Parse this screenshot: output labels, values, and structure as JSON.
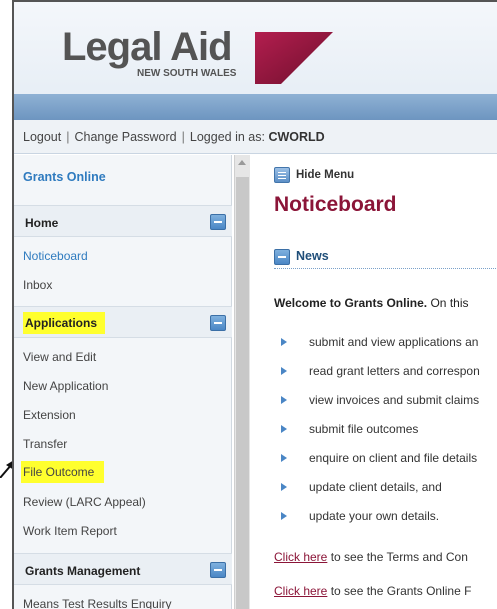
{
  "brand": {
    "logo_text": "Legal Aid",
    "logo_sub": "NEW SOUTH WALES",
    "colors": {
      "maroon": "#8b1538",
      "blue": "#2f7bbf",
      "highlight": "#ffff2e"
    }
  },
  "topbar": {
    "logout": "Logout",
    "sep1": "|",
    "change_password": "Change Password",
    "sep2": "|",
    "logged_in_label": "Logged in as:",
    "username": "CWORLD"
  },
  "sidebar": {
    "title": "Grants Online",
    "sections": [
      {
        "label": "Home",
        "items": [
          "Noticeboard",
          "Inbox"
        ]
      },
      {
        "label": "Applications",
        "items": [
          "View and Edit",
          "New Application",
          "Extension",
          "Transfer",
          "File Outcome",
          "Review (LARC Appeal)",
          "Work Item Report"
        ]
      },
      {
        "label": "Grants Management",
        "items": [
          "Means Test Results Enquiry"
        ]
      }
    ]
  },
  "main": {
    "hide_menu": "Hide Menu",
    "page_title": "Noticeboard",
    "news_label": "News",
    "welcome_bold": "Welcome to Grants Online.",
    "welcome_rest": " On this",
    "bullets": [
      "submit and view applications an",
      "read grant letters and correspon",
      "view invoices and submit claims",
      "submit file outcomes",
      "enquire on client and file details",
      "update client details, and",
      "update your own details."
    ],
    "links": [
      {
        "link": "Click here",
        "rest": " to see the Terms and Con"
      },
      {
        "link": "Click here",
        "rest": " to see the Grants Online F"
      }
    ]
  },
  "icons": {
    "logo_mark": "legal-aid-logo-mark",
    "toggle": "collapse-minus-icon",
    "menu": "hide-menu-icon",
    "bullet": "triangle-bullet-icon",
    "pointer": "annotation-arrow-icon"
  }
}
